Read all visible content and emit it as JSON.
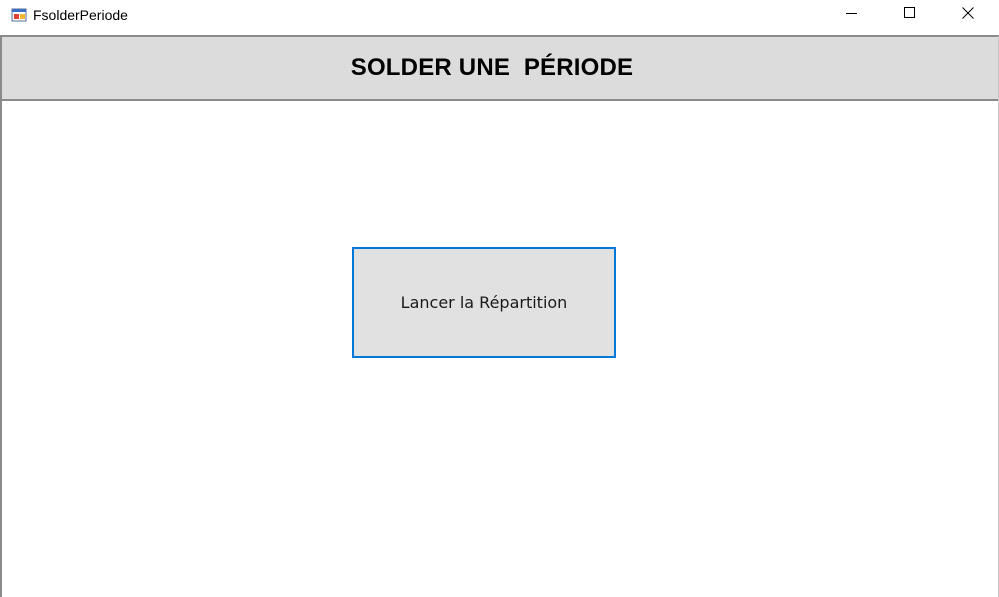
{
  "window": {
    "title": "FsolderPeriode",
    "controls": {
      "minimize_icon": "minimize-icon",
      "maximize_icon": "maximize-icon",
      "close_icon": "close-icon"
    }
  },
  "header": {
    "title": "SOLDER UNE  PÉRIODE"
  },
  "main": {
    "launch_button_label": "Lancer la Répartition"
  },
  "colors": {
    "header_bg": "#dcdcdc",
    "button_bg": "#e1e1e1",
    "button_focus_border": "#0078d7"
  }
}
